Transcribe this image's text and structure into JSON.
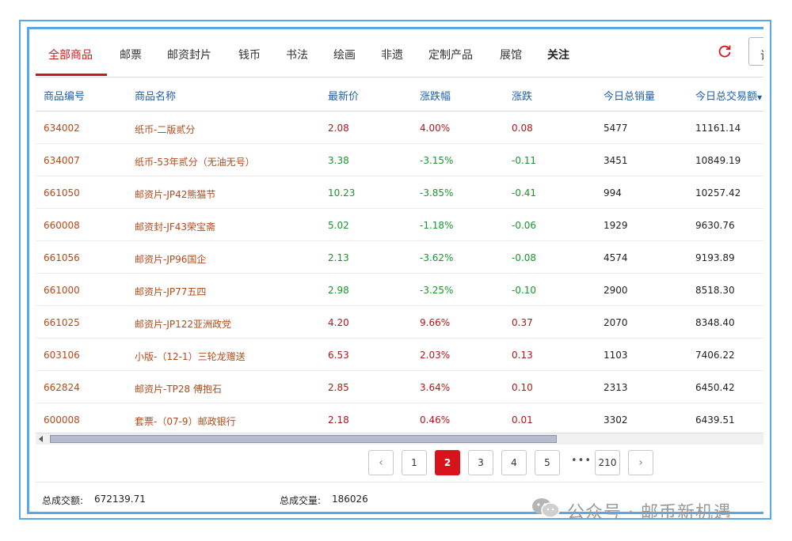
{
  "tabs": [
    {
      "label": "全部商品",
      "active": true
    },
    {
      "label": "邮票"
    },
    {
      "label": "邮资封片"
    },
    {
      "label": "钱币"
    },
    {
      "label": "书法"
    },
    {
      "label": "绘画"
    },
    {
      "label": "非遗"
    },
    {
      "label": "定制产品"
    },
    {
      "label": "展馆"
    },
    {
      "label": "关注"
    }
  ],
  "toolbar": {
    "request_button": "请",
    "refresh_icon": "refresh-icon"
  },
  "table": {
    "headers": [
      "商品编号",
      "商品名称",
      "最新价",
      "涨跌幅",
      "涨跌",
      "今日总销量",
      "今日总交易额"
    ],
    "rows": [
      [
        "634002",
        "纸币-二版贰分",
        "2.08",
        "4.00%",
        "0.08",
        "5477",
        "11161.14"
      ],
      [
        "634007",
        "纸币-53年贰分（无油无号）",
        "3.38",
        "-3.15%",
        "-0.11",
        "3451",
        "10849.19"
      ],
      [
        "661050",
        "邮资片-JP42熊猫节",
        "10.23",
        "-3.85%",
        "-0.41",
        "994",
        "10257.42"
      ],
      [
        "660008",
        "邮资封-JF43荣宝斋",
        "5.02",
        "-1.18%",
        "-0.06",
        "1929",
        "9630.76"
      ],
      [
        "661056",
        "邮资片-JP96国企",
        "2.13",
        "-3.62%",
        "-0.08",
        "4574",
        "9193.89"
      ],
      [
        "661000",
        "邮资片-JP77五四",
        "2.98",
        "-3.25%",
        "-0.10",
        "2900",
        "8518.30"
      ],
      [
        "661025",
        "邮资片-JP122亚洲政党",
        "4.20",
        "9.66%",
        "0.37",
        "2070",
        "8348.40"
      ],
      [
        "603106",
        "小版-（12-1）三轮龙赠送",
        "6.53",
        "2.03%",
        "0.13",
        "1103",
        "7406.22"
      ],
      [
        "662824",
        "邮资片-TP28 傅抱石",
        "2.85",
        "3.64%",
        "0.10",
        "2313",
        "6450.42"
      ],
      [
        "600008",
        "套票-（07-9）邮政银行",
        "2.18",
        "0.46%",
        "0.01",
        "3302",
        "6439.51"
      ]
    ]
  },
  "pagination": {
    "prev": "‹",
    "next": "›",
    "current": "2",
    "pages": [
      "1",
      "2",
      "3",
      "4",
      "5"
    ],
    "ellipsis": "•••",
    "last": "210"
  },
  "footer": {
    "total_amount_label": "总成交额:",
    "total_amount": "672139.71",
    "total_volume_label": "总成交量:",
    "total_volume": "186026"
  },
  "watermark": {
    "text": "公众号 · 邮币新机遇"
  },
  "colors": {
    "accent": "#c81a1a",
    "up": "#b0171a",
    "down": "#19952d",
    "header_text": "#1f5fa8",
    "frame": "#5aa7e6"
  }
}
